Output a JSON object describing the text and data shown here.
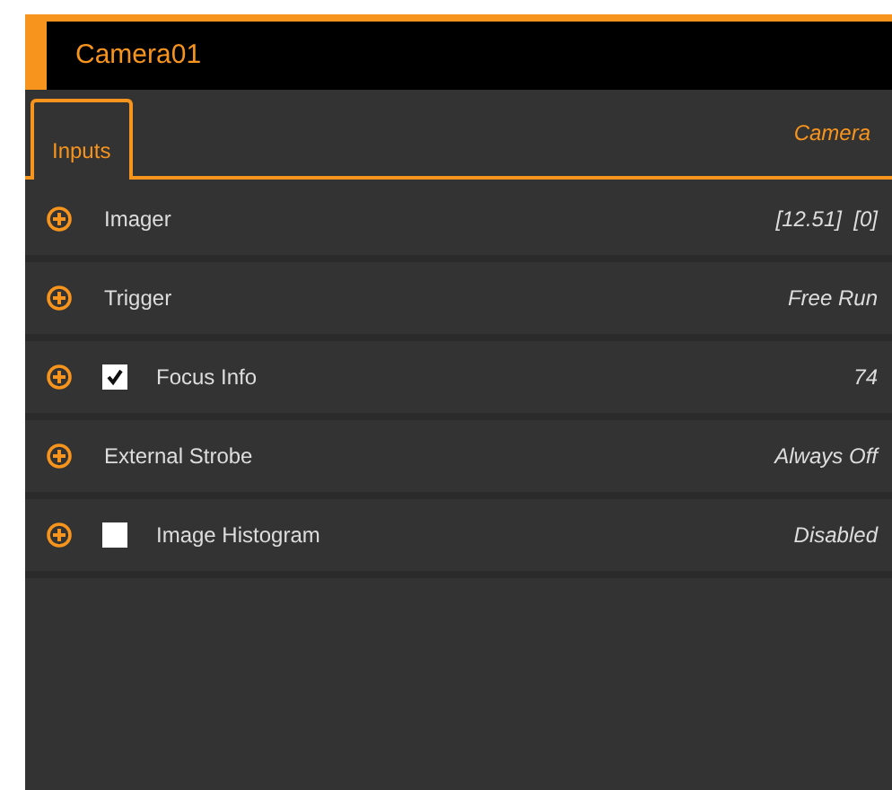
{
  "panel": {
    "title": "Camera01"
  },
  "tabs": [
    {
      "label": "Inputs",
      "selected": true
    }
  ],
  "section_label": "Camera",
  "rows": [
    {
      "kind": "plain",
      "label": "Imager",
      "value": "[12.51]  [0]"
    },
    {
      "kind": "plain",
      "label": "Trigger",
      "value": "Free Run"
    },
    {
      "kind": "checkbox",
      "label": "Focus Info",
      "checked": true,
      "value": "74"
    },
    {
      "kind": "plain",
      "label": "External Strobe",
      "value": "Always Off"
    },
    {
      "kind": "checkbox",
      "label": "Image Histogram",
      "checked": false,
      "value": "Disabled"
    }
  ]
}
